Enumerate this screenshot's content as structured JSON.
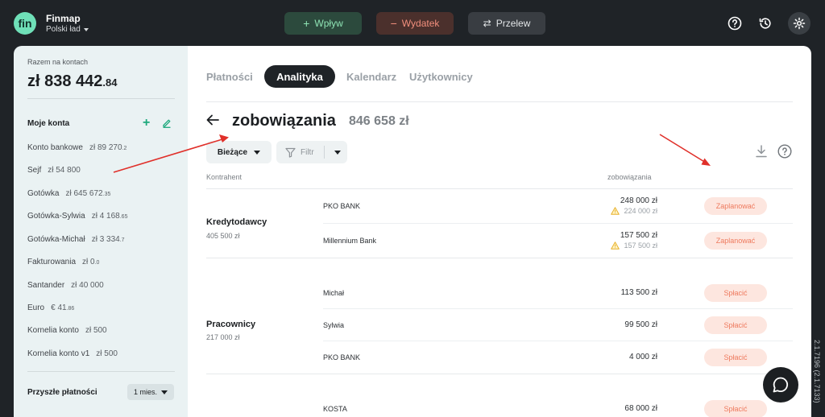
{
  "app": {
    "logo_text": "fin",
    "name": "Finmap",
    "workspace": "Polski ład"
  },
  "topbar": {
    "wplyw_label": "Wpływ",
    "wydatek_label": "Wydatek",
    "przelew_label": "Przelew",
    "icons": [
      "help-icon",
      "history-icon",
      "gear-icon"
    ]
  },
  "sidebar": {
    "total_label": "Razem na kontach",
    "total_main": "zł 838 442",
    "total_dec": ".84",
    "accounts_title": "Moje konta",
    "accounts": [
      {
        "name": "Konto bankowe",
        "amount": "zł 89 270",
        "dec": ".2"
      },
      {
        "name": "Sejf",
        "amount": "zł 54 800",
        "dec": ""
      },
      {
        "name": "Gotówka",
        "amount": "zł 645 672",
        "dec": ".35"
      },
      {
        "name": "Gotówka-Sylwia",
        "amount": "zł 4 168",
        "dec": ".65"
      },
      {
        "name": "Gotówka-Michał",
        "amount": "zł 3 334",
        "dec": ".7"
      },
      {
        "name": "Fakturowania",
        "amount": "zł 0",
        "dec": ".0"
      },
      {
        "name": "Santander",
        "amount": "zł 40 000",
        "dec": ""
      },
      {
        "name": "Euro",
        "amount": "€ 41",
        "dec": ".86"
      },
      {
        "name": "Kornelia konto",
        "amount": "zł 500",
        "dec": ""
      },
      {
        "name": "Kornelia konto v1",
        "amount": "zł 500",
        "dec": ""
      }
    ],
    "future_title": "Przyszłe płatności",
    "future_period": "1 mies."
  },
  "main": {
    "tabs": [
      {
        "label": "Płatności",
        "active": false
      },
      {
        "label": "Analityka",
        "active": true
      },
      {
        "label": "Kalendarz",
        "active": false
      },
      {
        "label": "Użytkownicy",
        "active": false
      }
    ],
    "title": "zobowiązania",
    "title_amount": "846 658 zł",
    "filter_period": "Bieżące",
    "filter_label": "Filtr",
    "columns": {
      "kontrahent": "Kontrahent",
      "zobowiazania": "zobowiązania"
    },
    "groups": [
      {
        "name": "Kredytodawcy",
        "sum": "405 500 zł",
        "rows": [
          {
            "name": "PKO BANK",
            "amount": "248 000 zł",
            "sub": "224 000 zł",
            "action": "Zaplanować"
          },
          {
            "name": "Millennium Bank",
            "amount": "157 500 zł",
            "sub": "157 500 zł",
            "action": "Zaplanować"
          }
        ]
      },
      {
        "name": "Pracownicy",
        "sum": "217 000 zł",
        "rows": [
          {
            "name": "Michał",
            "amount": "113 500 zł",
            "action": "Spłacić"
          },
          {
            "name": "Sylwia",
            "amount": "99 500 zł",
            "action": "Spłacić"
          },
          {
            "name": "PKO BANK",
            "amount": "4 000 zł",
            "action": "Spłacić"
          }
        ]
      },
      {
        "name": "",
        "sum": "",
        "rows": [
          {
            "name": "KOSTA",
            "amount": "68 000 zł",
            "action": "Spłacić"
          }
        ]
      }
    ]
  },
  "version": "2.1.7196 (2.1.7133)",
  "colors": {
    "accent": "#6fe0b8",
    "annotation": "#e0302a",
    "action_bg": "#fde6df",
    "action_text": "#ee7a5e"
  }
}
